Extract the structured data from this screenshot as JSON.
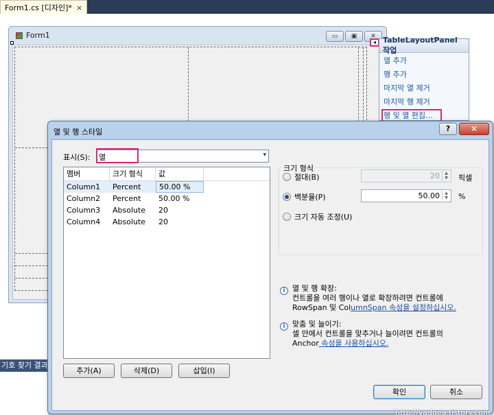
{
  "ide": {
    "doc_tab": "Form1.cs [디자인]*",
    "doc_tab_close": "×",
    "tool_window_title": "기호 찾기 결과"
  },
  "form1": {
    "title": "Form1",
    "btn_min": "▭",
    "btn_max": "▣",
    "btn_close": "✕",
    "smart_tag_glyph": "◂"
  },
  "tasks_panel": {
    "title": "TableLayoutPanel 작업",
    "items": [
      "열 추가",
      "행 추가",
      "마지막 열 제거",
      "마지막 행 제거",
      "행 및 열 편집..."
    ]
  },
  "dialog": {
    "title": "열 및 행 스타일",
    "help": "?",
    "close": "✕",
    "show_label": "표시(S):",
    "show_value": "열",
    "dropdown_arrow": "▾",
    "columns": [
      "멤버",
      "크기 형식",
      "값"
    ],
    "rows": [
      {
        "member": "Column1",
        "type": "Percent",
        "value": "50.00 %"
      },
      {
        "member": "Column2",
        "type": "Percent",
        "value": "50.00 %"
      },
      {
        "member": "Column3",
        "type": "Absolute",
        "value": "20"
      },
      {
        "member": "Column4",
        "type": "Absolute",
        "value": "20"
      }
    ],
    "add_button": "추가(A)",
    "delete_button": "삭제(D)",
    "insert_button": "삽입(I)",
    "size_group_title": "크기 형식",
    "absolute_label": "절대(B)",
    "absolute_value": "20",
    "absolute_unit": "픽셀",
    "percent_label": "백분율(P)",
    "percent_value": "50.00",
    "percent_unit": "%",
    "auto_label": "크기 자동 조정(U)",
    "info1_title": "열 및 행 확장:",
    "info1_line1": "컨트롤을 여러 행이나 열로 확장하려면 컨트롤에",
    "info1_line2_prefix": "RowSpan 및 Col",
    "info1_line2_link": "umnSpan 속성을 설정하십시오.",
    "info2_title": "맞춤 및 늘이기:",
    "info2_line1": "셀 안에서 컨트롤을 맞추거나 늘이려면 컨트롤의",
    "info2_line2_prefix": "Anchor",
    "info2_line2_link": " 속성을 사용하십시오.",
    "ok_button": "확인",
    "cancel_button": "취소",
    "watermark": "http://vadgea.tistory.com"
  }
}
